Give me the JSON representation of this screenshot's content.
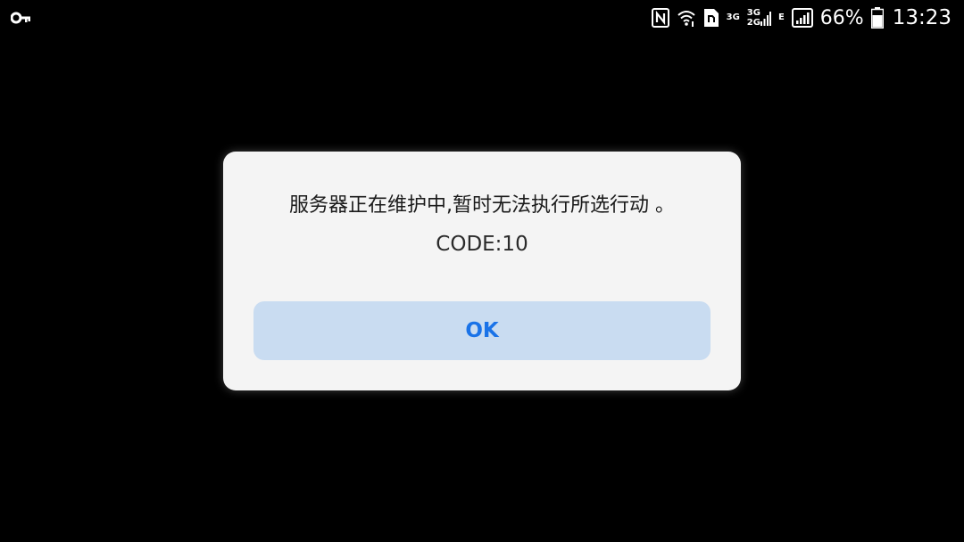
{
  "status_bar": {
    "left_icon": "vpn-key-icon",
    "icons": [
      "nfc-icon",
      "wifi-icon",
      "sim-card-icon",
      "signal-icon",
      "battery-icon"
    ],
    "network_1": "3G",
    "network_2_top": "3G",
    "network_2_bottom": "2G",
    "network_3": "E",
    "battery_percent": "66%",
    "time": "13:23"
  },
  "dialog": {
    "message": "服务器正在维护中,暂时无法执行所选行动 。",
    "code": "CODE:10",
    "ok_label": "OK"
  },
  "colors": {
    "background": "#000000",
    "dialog_bg": "#f4f4f4",
    "button_bg": "#c9dcf1",
    "button_text": "#1a73e8"
  }
}
